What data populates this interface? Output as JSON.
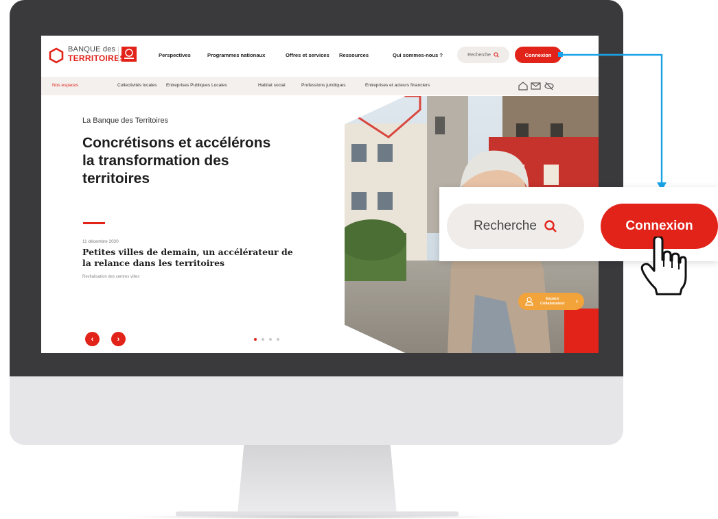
{
  "brand": {
    "name_top": "BANQUE des",
    "name_bottom": "TERRITOIRES"
  },
  "header": {
    "nav": [
      "Perspectives",
      "Programmes nationaux",
      "Offres et services",
      "Ressources",
      "Qui sommes-nous ?"
    ],
    "search_label": "Recherche",
    "login_label": "Connexion"
  },
  "subnav": {
    "label": "Nos espaces",
    "items": [
      "Collectivités locales",
      "Entreprises Publiques Locales",
      "Habitat social",
      "Professions juridiques",
      "Entreprises et acteurs financiers"
    ],
    "icons": [
      "home-icon",
      "mail-icon",
      "accessibility-eye-icon"
    ]
  },
  "hero": {
    "kicker": "La Banque des Territoires",
    "title": "Concrétisons et accélérons la transformation des territoires",
    "news_date": "11 décembre 2020",
    "news_title": "Petites villes de demain, un accélérateur de la relance dans les territoires",
    "news_tag": "Revitalisation des centres villes",
    "slide_count": 4,
    "active_slide": 1,
    "espace_line1": "Espace",
    "espace_line2": "Collaborateur"
  },
  "zoom": {
    "search_label": "Recherche",
    "login_label": "Connexion"
  },
  "colors": {
    "brand_red": "#e2231a",
    "accent_orange": "#f2a33a",
    "callout_blue": "#1aa3e8",
    "monitor_frame": "#3a3a3c"
  }
}
